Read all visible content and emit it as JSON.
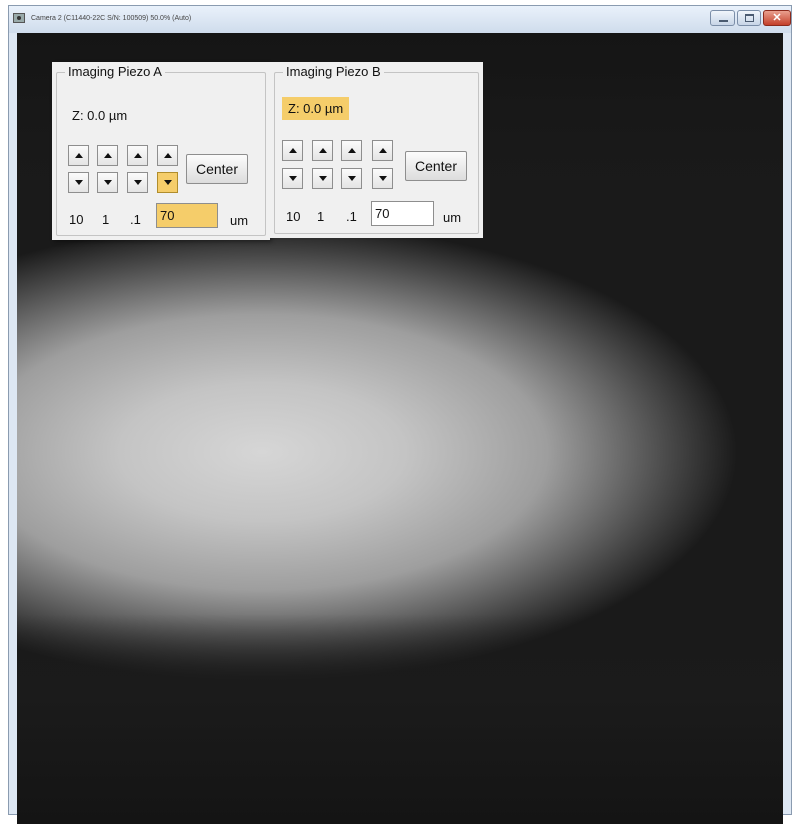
{
  "window": {
    "title": "Camera 2 (C11440-22C S/N: 100509) 50.0% (Auto)",
    "close_glyph": "✕",
    "icons": [
      "camera-icon",
      "minimize-icon",
      "maximize-icon",
      "close-icon"
    ]
  },
  "colors": {
    "highlight": "#f5cd6a",
    "panel_bg": "#f0f0f0",
    "titlebar": "#dde7f3",
    "close_button": "#c4402a"
  },
  "piezo_a": {
    "title": "Imaging Piezo A",
    "z_label": "Z: 0.0 µm",
    "center_label": "Center",
    "step_labels": [
      "10",
      "1",
      ".1"
    ],
    "step_value": "70",
    "unit": "um"
  },
  "piezo_b": {
    "title": "Imaging Piezo B",
    "z_label": "Z: 0.0 µm",
    "center_label": "Center",
    "step_labels": [
      "10",
      "1",
      ".1"
    ],
    "step_value": "70",
    "unit": "um"
  }
}
